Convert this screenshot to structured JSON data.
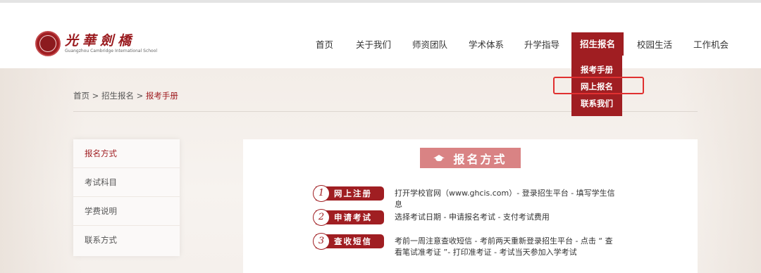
{
  "brand": {
    "name_cn": "光華劍橋",
    "name_en": "Guangzhou Cambridge International School"
  },
  "nav": {
    "items": [
      {
        "label": "首页"
      },
      {
        "label": "关于我们"
      },
      {
        "label": "师资团队"
      },
      {
        "label": "学术体系"
      },
      {
        "label": "升学指导"
      },
      {
        "label": "招生报名"
      },
      {
        "label": "校园生活"
      },
      {
        "label": "工作机会"
      }
    ],
    "active": "招生报名",
    "dropdown": [
      {
        "label": "报考手册"
      },
      {
        "label": "网上报名"
      },
      {
        "label": "联系我们"
      }
    ]
  },
  "breadcrumb": {
    "home": "首页",
    "sep": " > ",
    "section": "招生报名",
    "current": "报考手册"
  },
  "sidebar": {
    "items": [
      {
        "label": "报名方式"
      },
      {
        "label": "考试科目"
      },
      {
        "label": "学费说明"
      },
      {
        "label": "联系方式"
      }
    ],
    "active": "报名方式"
  },
  "panel": {
    "title": "报名方式",
    "steps": [
      {
        "num": "1",
        "label": "网上注册",
        "desc": "打开学校官网（www.ghcis.com）- 登录招生平台 - 填写学生信息"
      },
      {
        "num": "2",
        "label": "申请考试",
        "desc": "选择考试日期 - 申请报名考试 - 支付考试费用"
      },
      {
        "num": "3",
        "label": "查收短信",
        "desc": "考前一周注意查收短信 - 考前两天重新登录招生平台 - 点击 “ 查看笔试准考证 ”- 打印准考证 - 考试当天参加入学考试"
      }
    ]
  },
  "colors": {
    "brand_red": "#a01e22",
    "title_pink": "#d98384",
    "highlight_red": "#e03030"
  }
}
